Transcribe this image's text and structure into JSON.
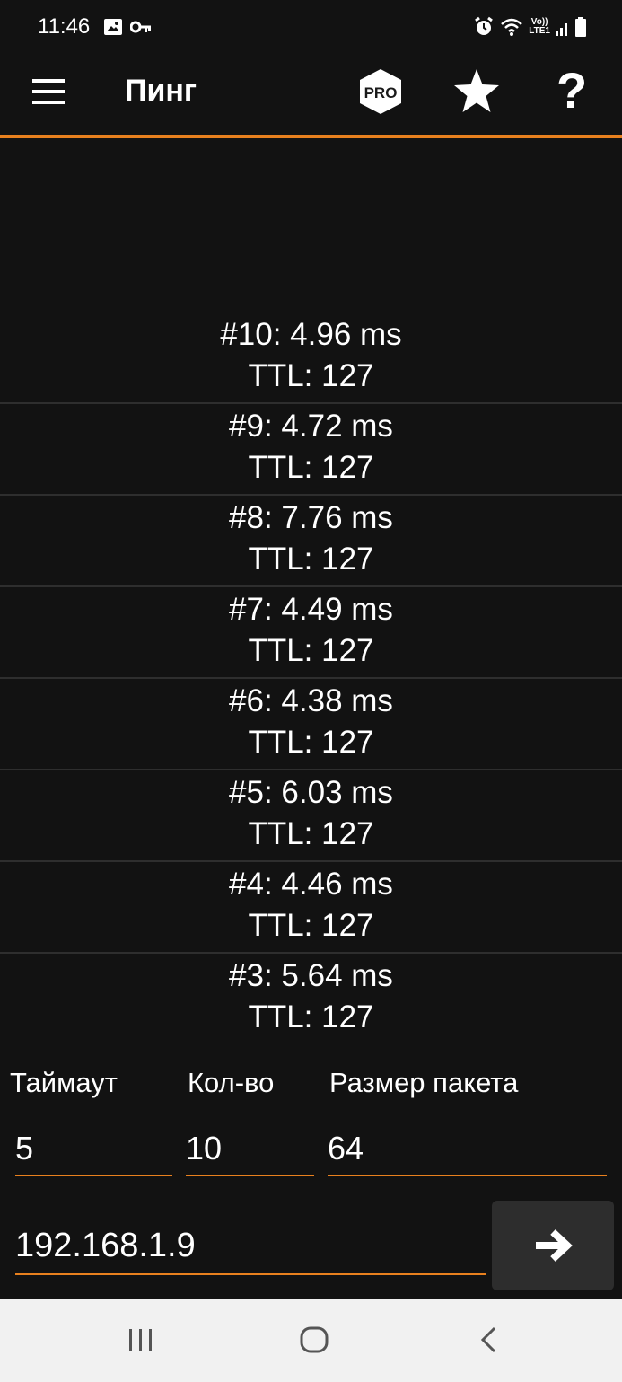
{
  "status_bar": {
    "time": "11:46",
    "network_label_top": "Vo))",
    "network_label_bottom": "LTE1"
  },
  "app_bar": {
    "title": "Пинг",
    "pro_badge": "PRO",
    "help_label": "?"
  },
  "results": [
    {
      "time": "#10: 4.96 ms",
      "ttl": "TTL: 127"
    },
    {
      "time": "#9: 4.72 ms",
      "ttl": "TTL: 127"
    },
    {
      "time": "#8: 7.76 ms",
      "ttl": "TTL: 127"
    },
    {
      "time": "#7: 4.49 ms",
      "ttl": "TTL: 127"
    },
    {
      "time": "#6: 4.38 ms",
      "ttl": "TTL: 127"
    },
    {
      "time": "#5: 6.03 ms",
      "ttl": "TTL: 127"
    },
    {
      "time": "#4: 4.46 ms",
      "ttl": "TTL: 127"
    },
    {
      "time": "#3: 5.64 ms",
      "ttl": "TTL: 127"
    }
  ],
  "settings": {
    "timeout_label": "Таймаут",
    "timeout_value": "5",
    "count_label": "Кол-во",
    "count_value": "10",
    "packet_size_label": "Размер пакета",
    "packet_size_value": "64",
    "host_value": "192.168.1.9"
  },
  "colors": {
    "accent": "#e8801e",
    "background": "#121212",
    "divider": "#2e2e2e",
    "nav_bar": "#f1f1f1"
  }
}
